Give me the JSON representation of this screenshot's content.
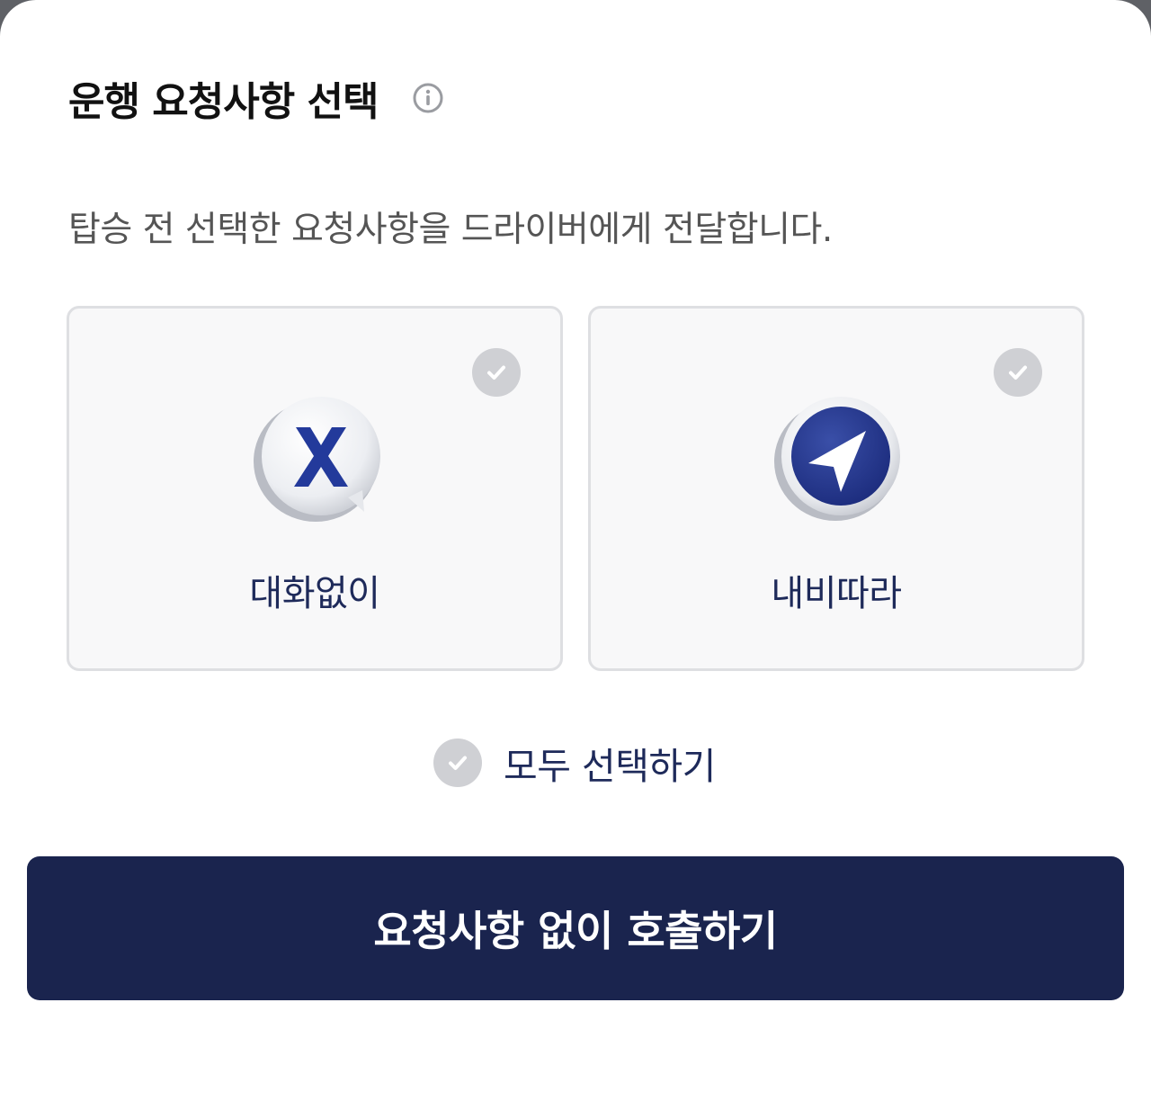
{
  "header": {
    "title": "운행 요청사항 선택",
    "info_icon": "info-icon"
  },
  "subtitle": "탑승 전 선택한 요청사항을 드라이버에게 전달합니다.",
  "options": [
    {
      "label": "대화없이",
      "icon": "no-chat-icon",
      "selected": false
    },
    {
      "label": "내비따라",
      "icon": "navigation-arrow-icon",
      "selected": false
    }
  ],
  "select_all": {
    "label": "모두 선택하기",
    "selected": false
  },
  "cta": {
    "label": "요청사항 없이 호출하기"
  },
  "colors": {
    "brand_navy": "#1a244e",
    "label_navy": "#1e2a5a",
    "check_gray": "#cfd0d4",
    "card_bg": "#f8f8f9",
    "card_border": "#dedfe2"
  }
}
